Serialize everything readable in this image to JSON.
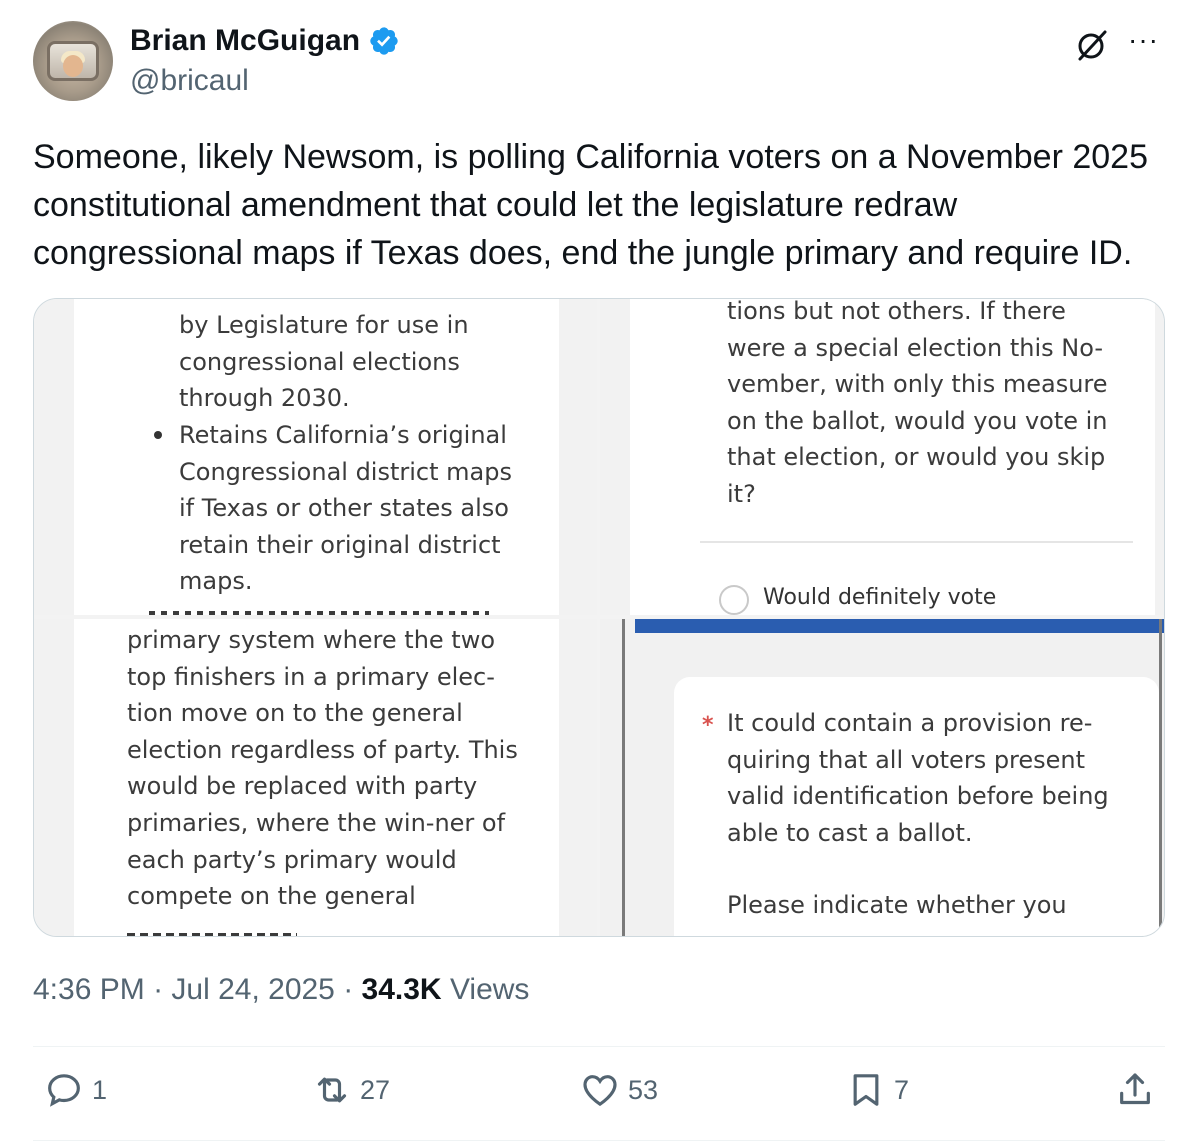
{
  "author": {
    "name": "Brian McGuigan",
    "handle": "@bricaul",
    "verified": true
  },
  "icons": {
    "verified": "verified-badge-icon",
    "grok": "grok-icon",
    "more": "more-icon"
  },
  "tweet": {
    "text": "Someone, likely Newsom, is polling California voters on a November 2025 constitutional amendment that could let the legislature redraw congressional maps if Texas does, end the jungle primary and require ID."
  },
  "media": {
    "pane1": {
      "text_a": "by Legislature for use in congressional elections through 2030.",
      "text_b": "Retains California’s original Congressional district maps if Texas or other states also retain their original district maps."
    },
    "pane2": {
      "text": "tions but not others. If there were a special election this No-vember, with only this measure on the ballot, would you vote in that election, or would you skip it?",
      "option": "Would definitely vote"
    },
    "pane3": {
      "text": "primary system where the two top finishers in a primary elec-tion move on to the general election regardless of party. This would be replaced with party primaries, where the win-ner of each party’s primary would compete on the general"
    },
    "pane4": {
      "required_marker": "*",
      "text": "It could contain a provision re-quiring that all voters present valid identification before being able to cast a ballot.",
      "prompt": "Please indicate whether you"
    }
  },
  "meta": {
    "time": "4:36 PM",
    "date": "Jul 24, 2025",
    "views_count": "34.3K",
    "views_label": "Views"
  },
  "actions": {
    "replies": "1",
    "reposts": "27",
    "likes": "53",
    "bookmarks": "7"
  },
  "colors": {
    "verified": "#1d9bf0",
    "text_primary": "#0f1419",
    "text_secondary": "#536471",
    "survey_bar": "#2a5db0",
    "required": "#d9534f"
  }
}
